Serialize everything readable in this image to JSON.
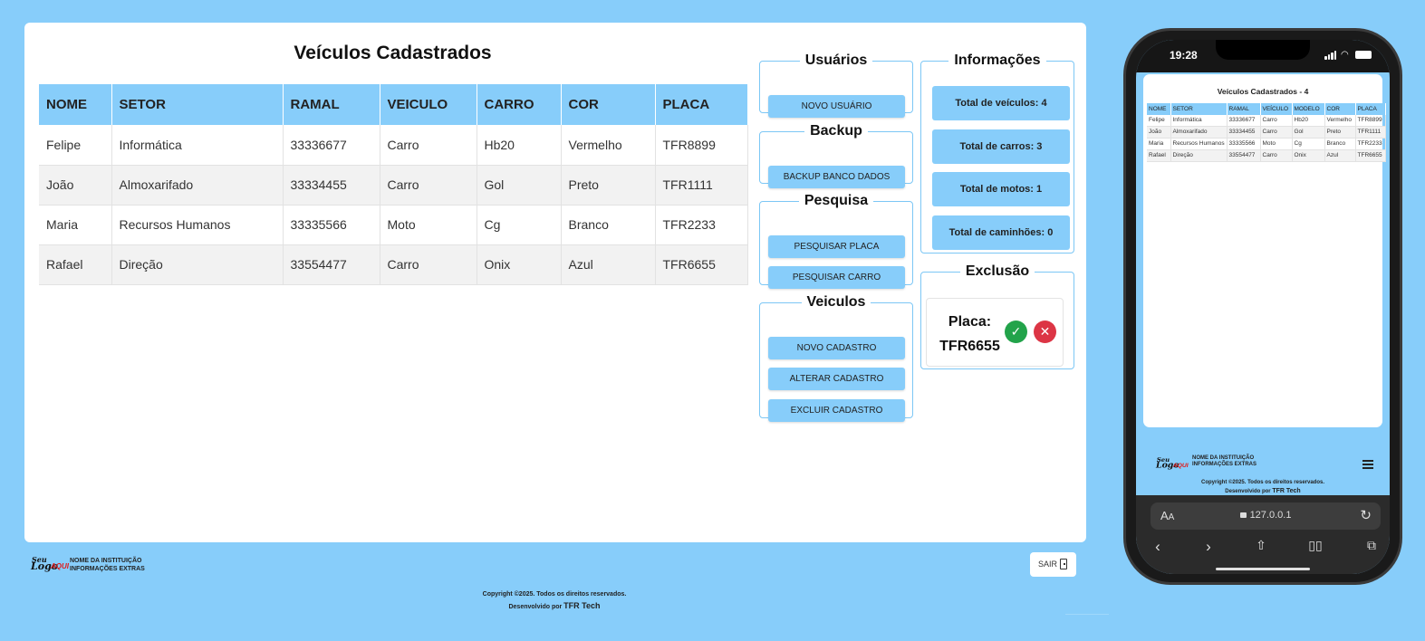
{
  "page": {
    "title": "Veículos Cadastrados"
  },
  "table": {
    "headers": [
      "NOME",
      "SETOR",
      "RAMAL",
      "VEICULO",
      "CARRO",
      "COR",
      "PLACA"
    ],
    "rows": [
      [
        "Felipe",
        "Informática",
        "33336677",
        "Carro",
        "Hb20",
        "Vermelho",
        "TFR8899"
      ],
      [
        "João",
        "Almoxarifado",
        "33334455",
        "Carro",
        "Gol",
        "Preto",
        "TFR1111"
      ],
      [
        "Maria",
        "Recursos Humanos",
        "33335566",
        "Moto",
        "Cg",
        "Branco",
        "TFR2233"
      ],
      [
        "Rafael",
        "Direção",
        "33554477",
        "Carro",
        "Onix",
        "Azul",
        "TFR6655"
      ]
    ]
  },
  "panels": {
    "usuarios": {
      "title": "Usuários",
      "buttons": [
        "NOVO USUÁRIO"
      ]
    },
    "backup": {
      "title": "Backup",
      "buttons": [
        "BACKUP BANCO DADOS"
      ]
    },
    "pesquisa": {
      "title": "Pesquisa",
      "buttons": [
        "PESQUISAR PLACA",
        "PESQUISAR CARRO"
      ]
    },
    "veiculos": {
      "title": "Veiculos",
      "buttons": [
        "NOVO CADASTRO",
        "ALTERAR CADASTRO",
        "EXCLUIR CADASTRO"
      ]
    },
    "informacoes": {
      "title": "Informações",
      "items": [
        "Total de veículos: 4",
        "Total de carros: 3",
        "Total de motos: 1",
        "Total de caminhões: 0"
      ]
    },
    "exclusao": {
      "title": "Exclusão",
      "label": "Placa:",
      "plate": "TFR6655",
      "confirm_glyph": "✓",
      "cancel_glyph": "✕"
    }
  },
  "footer": {
    "logo": {
      "line1": "Seu",
      "line2": "Logo",
      "line3": "AQUI"
    },
    "institution": "NOME DA INSTITUIÇÃO",
    "extra": "INFORMAÇÕES EXTRAS",
    "copyright": "Copyright ©2025. Todos os direitos reservados.",
    "developed_by": "Desenvolvido por",
    "brand": "TFR Tech",
    "logout_label": "SAIR"
  },
  "mobile": {
    "status_time": "19:28",
    "title": "Veículos Cadastrados - 4",
    "headers": [
      "NOME",
      "SETOR",
      "RAMAL",
      "VEÍCULO",
      "MODELO",
      "COR",
      "PLACA"
    ],
    "rows": [
      [
        "Felipe",
        "Informática",
        "33336677",
        "Carro",
        "Hb20",
        "Vermelho",
        "TFR8899"
      ],
      [
        "João",
        "Almoxarifado",
        "33334455",
        "Carro",
        "Gol",
        "Preto",
        "TFR1111"
      ],
      [
        "Maria",
        "Recursos Humanos",
        "33335566",
        "Moto",
        "Cg",
        "Branco",
        "TFR2233"
      ],
      [
        "Rafael",
        "Direção",
        "33554477",
        "Carro",
        "Onix",
        "Azul",
        "TFR6655"
      ]
    ],
    "url": "127.0.0.1",
    "text_size_label": "A",
    "text_size_small": "A"
  },
  "colors": {
    "background": "#87cdfa",
    "header": "#87cdfa",
    "confirm": "#22a34a",
    "cancel": "#dc3545"
  },
  "icons": [
    "check-icon",
    "close-icon",
    "door-exit-icon",
    "hamburger-menu-icon",
    "lock-icon",
    "reload-icon",
    "back-icon",
    "forward-icon",
    "share-icon",
    "bookmarks-icon",
    "tabs-icon"
  ]
}
